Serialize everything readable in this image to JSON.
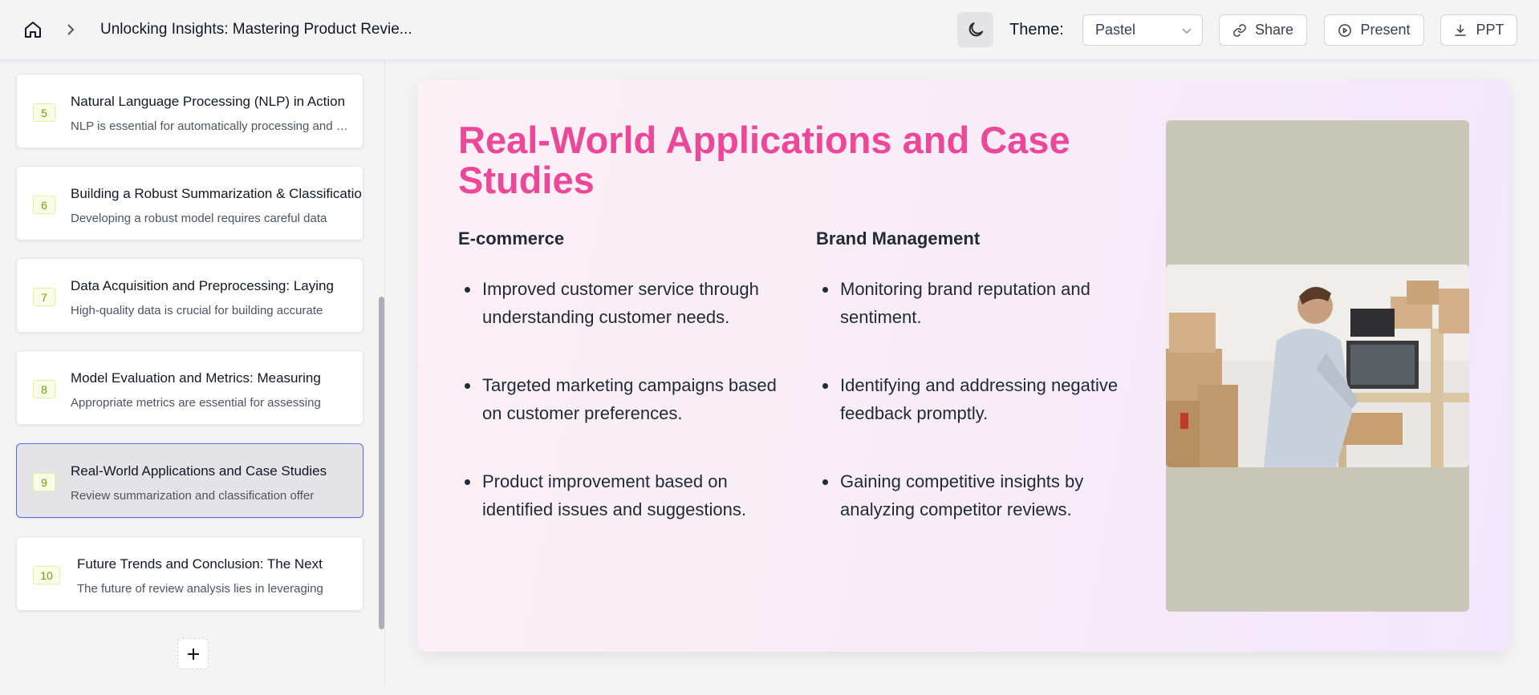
{
  "header": {
    "breadcrumb_title": "Unlocking Insights: Mastering Product Revie...",
    "theme_label": "Theme:",
    "theme_value": "Pastel",
    "share_label": "Share",
    "present_label": "Present",
    "ppt_label": "PPT"
  },
  "sidebar": {
    "slides": [
      {
        "num": "5",
        "title": "Natural Language Processing (NLP) in Action",
        "desc": "NLP is essential for automatically processing and analyzing"
      },
      {
        "num": "6",
        "title": "Building a Robust Summarization & Classification",
        "desc": "Developing a robust model requires careful data"
      },
      {
        "num": "7",
        "title": "Data Acquisition and Preprocessing: Laying",
        "desc": "High-quality data is crucial for building accurate"
      },
      {
        "num": "8",
        "title": "Model Evaluation and Metrics: Measuring",
        "desc": "Appropriate metrics are essential for assessing"
      },
      {
        "num": "9",
        "title": "Real-World Applications and Case Studies",
        "desc": "Review summarization and classification offer"
      },
      {
        "num": "10",
        "title": "Future Trends and Conclusion: The Next",
        "desc": "The future of review analysis lies in leveraging"
      }
    ]
  },
  "slide": {
    "title": "Real-World Applications and Case Studies",
    "columns": [
      {
        "heading": "E-commerce",
        "bullets": [
          "Improved customer service through understanding customer needs.",
          "Targeted marketing campaigns based on customer preferences.",
          "Product improvement based on identified issues and suggestions."
        ]
      },
      {
        "heading": "Brand Management",
        "bullets": [
          "Monitoring brand reputation and sentiment.",
          "Identifying and addressing negative feedback promptly.",
          "Gaining competitive insights by analyzing competitor reviews."
        ]
      }
    ]
  },
  "colors": {
    "accent_title": "#ec4899",
    "active_border": "#6366f1",
    "slide_number_text": "#65a30d"
  }
}
